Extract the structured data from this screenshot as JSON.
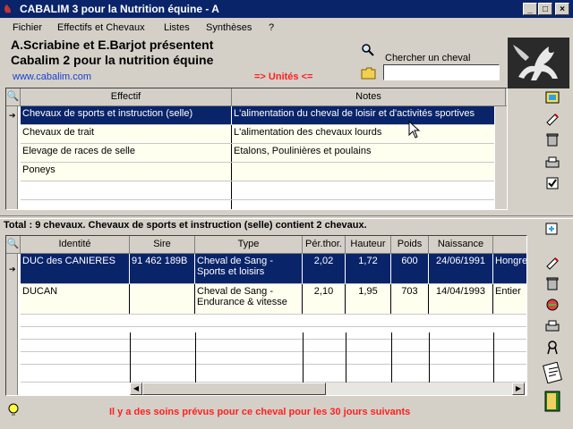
{
  "window": {
    "title": "CABALIM 3 pour la Nutrition équine - A"
  },
  "menu": [
    "Fichier",
    "Effectifs et Chevaux",
    "Listes",
    "Synthèses",
    "?"
  ],
  "header": {
    "line1": "A.Scriabine et E.Barjot présentent",
    "line2": "Cabalim 2 pour la nutrition équine",
    "website": "www.cabalim.com",
    "units": "=> Unités <=",
    "search_label": "Chercher un cheval",
    "search_value": ""
  },
  "effectif_grid": {
    "columns": [
      "Effectif",
      "Notes"
    ],
    "rows": [
      [
        "Chevaux de sports et instruction (selle)",
        "L'alimentation du cheval de loisir et d'activités sportives"
      ],
      [
        "Chevaux de trait",
        "L'alimentation des chevaux lourds"
      ],
      [
        "Elevage de races de selle",
        "Etalons, Poulinières et poulains"
      ],
      [
        "Poneys",
        ""
      ]
    ],
    "selected_index": 0
  },
  "total_text": "Total : 9 chevaux. Chevaux de sports et instruction (selle) contient 2 chevaux.",
  "horse_grid": {
    "columns": [
      "Identité",
      "Sire",
      "Type",
      "Pér.thor.",
      "Hauteur",
      "Poids",
      "Naissance",
      ""
    ],
    "rows": [
      {
        "identite": "DUC des CANIERES",
        "sire": "91 462 189B",
        "type1": "Cheval de Sang -",
        "type2": "Sports et loisirs",
        "perthor": "2,02",
        "hauteur": "1,72",
        "poids": "600",
        "naissance": "24/06/1991",
        "extra": "Hongre"
      },
      {
        "identite": "DUCAN",
        "sire": "",
        "type1": "Cheval de Sang -",
        "type2": "Endurance & vitesse",
        "perthor": "2,10",
        "hauteur": "1,95",
        "poids": "703",
        "naissance": "14/04/1993",
        "extra": "Entier"
      }
    ],
    "selected_index": 0
  },
  "alert": "Il y a des soins prévus pour ce cheval pour les 30 jours suivants",
  "icons": {
    "window": "horse-icon",
    "search": "magnifier-icon",
    "folder": "folder-icon",
    "logo": "pegasus-logo"
  }
}
